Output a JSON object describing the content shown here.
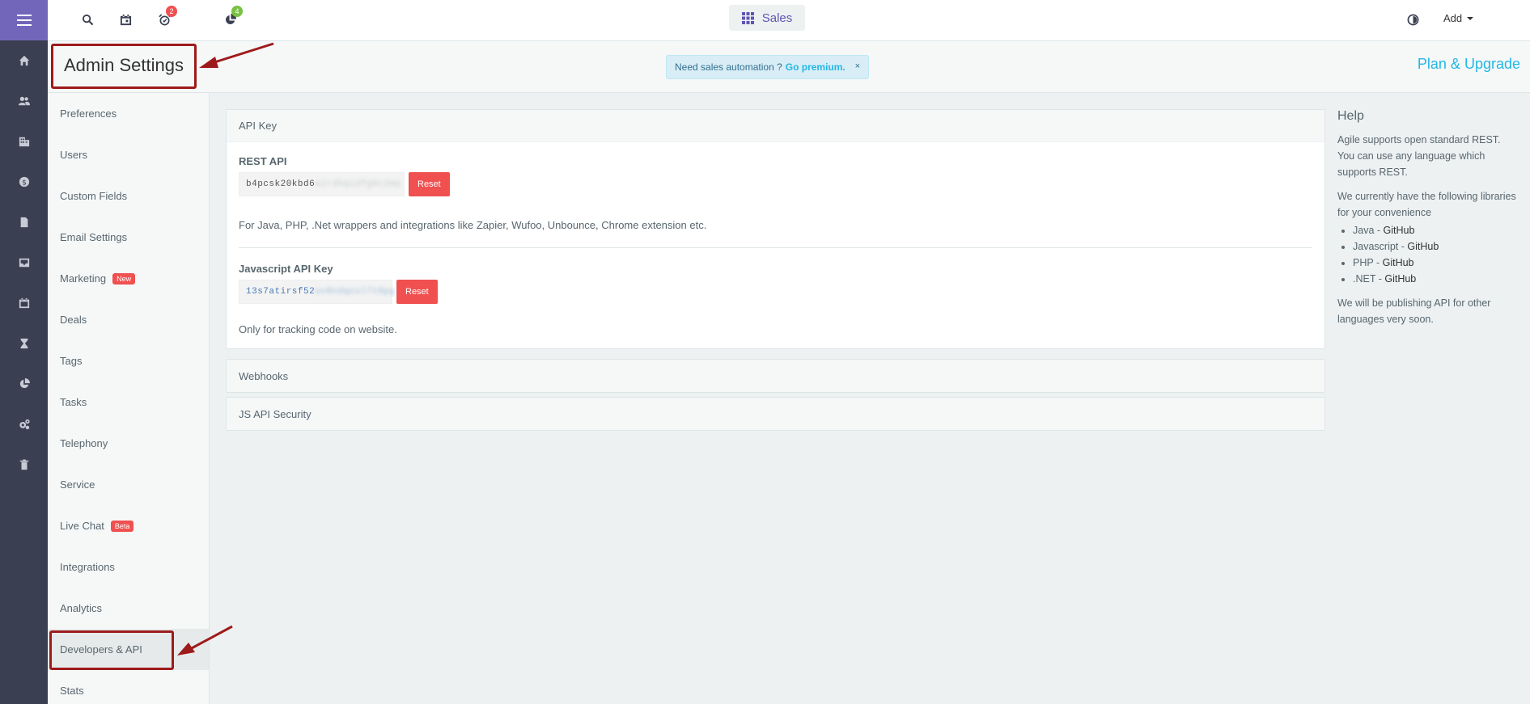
{
  "topbar": {
    "notif_badge": "2",
    "reports_badge": "4",
    "module_label": "Sales",
    "add_label": "Add"
  },
  "subheader": {
    "title": "Admin Settings",
    "promo_text": "Need sales automation ?",
    "promo_link": "Go premium.",
    "promo_close": "×",
    "plan_link": "Plan & Upgrade"
  },
  "nav": {
    "items": [
      {
        "label": "Preferences"
      },
      {
        "label": "Users"
      },
      {
        "label": "Custom Fields"
      },
      {
        "label": "Email Settings"
      },
      {
        "label": "Marketing",
        "badge": "New"
      },
      {
        "label": "Deals"
      },
      {
        "label": "Tags"
      },
      {
        "label": "Tasks"
      },
      {
        "label": "Telephony"
      },
      {
        "label": "Service"
      },
      {
        "label": "Live Chat",
        "badge": "Beta"
      },
      {
        "label": "Integrations"
      },
      {
        "label": "Analytics"
      },
      {
        "label": "Developers & API"
      },
      {
        "label": "Stats"
      }
    ]
  },
  "api": {
    "section_title": "API Key",
    "rest_label": "REST API",
    "rest_key_visible": "b4pcsk20kbd6",
    "rest_key_hidden": "airdhqidfg0c2mp",
    "reset_label": "Reset",
    "rest_desc": "For Java, PHP, .Net wrappers and integrations like Zapier, Wufoo, Unbounce, Chrome extension etc.",
    "js_label": "Javascript API Key",
    "js_key_visible": "13s7atirsf52",
    "js_key_hidden": "uv8ndqcul7t0pg",
    "js_desc": "Only for tracking code on website."
  },
  "panels": {
    "webhooks": "Webhooks",
    "js_security": "JS API Security"
  },
  "help": {
    "title": "Help",
    "intro": "Agile supports open standard REST. You can use any language which supports REST.",
    "libs_intro": "We currently have the following libraries for your convenience",
    "libraries": [
      {
        "lang": "Java",
        "link": "GitHub"
      },
      {
        "lang": "Javascript",
        "link": "GitHub"
      },
      {
        "lang": "PHP",
        "link": "GitHub"
      },
      {
        "lang": ".NET",
        "link": "GitHub"
      }
    ],
    "outro": "We will be publishing API for other languages very soon."
  },
  "colors": {
    "rail": "#3a3f51",
    "rail_top": "#7266ba",
    "accent": "#23b7e5",
    "danger": "#f05050",
    "annotation": "#9e1b1b"
  }
}
